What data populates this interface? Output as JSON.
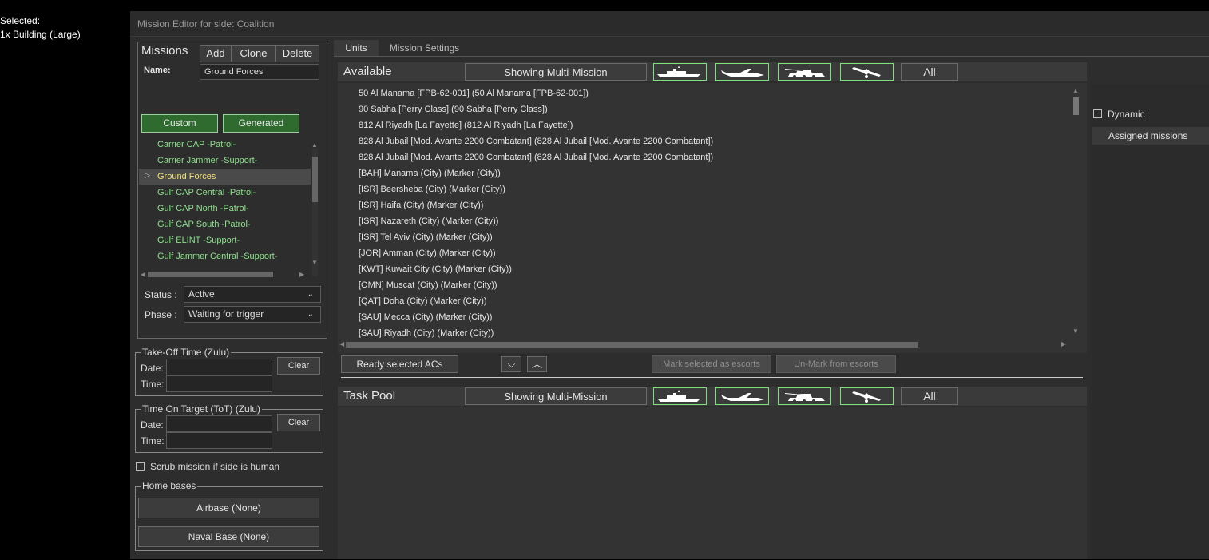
{
  "selection": {
    "line1": "Selected:",
    "line2": "1x Building (Large)"
  },
  "editor": {
    "title": "Mission Editor for side: Coalition"
  },
  "missions": {
    "header": "Missions",
    "add_label": "Add",
    "clone_label": "Clone",
    "delete_label": "Delete",
    "name_label": "Name:",
    "name_value": "Ground Forces",
    "custom_label": "Custom",
    "generated_label": "Generated",
    "items": [
      "Carrier CAP  -Patrol-",
      "Carrier Jammer  -Support-",
      "Ground Forces",
      "Gulf CAP Central  -Patrol-",
      "Gulf CAP North  -Patrol-",
      "Gulf CAP South  -Patrol-",
      "Gulf ELINT  -Support-",
      "Gulf Jammer Central  -Support-"
    ],
    "selected_index": 2,
    "status_label": "Status :",
    "status_value": "Active",
    "phase_label": "Phase :",
    "phase_value": "Waiting for trigger"
  },
  "takeoff": {
    "legend": "Take-Off Time (Zulu)",
    "date_label": "Date:",
    "time_label": "Time:",
    "clear_label": "Clear"
  },
  "tot": {
    "legend": "Time On Target (ToT) (Zulu)",
    "date_label": "Date:",
    "time_label": "Time:",
    "clear_label": "Clear"
  },
  "scrub_label": "Scrub mission if side is human",
  "home_bases": {
    "legend": "Home bases",
    "airbase": "Airbase (None)",
    "naval": "Naval Base (None)"
  },
  "tabs": {
    "units": "Units",
    "mission_settings": "Mission Settings"
  },
  "available": {
    "header": "Available",
    "filter_label": "Showing Multi-Mission",
    "all_label": "All",
    "rows": [
      "50 Al Manama [FPB-62-001] (50 Al Manama [FPB-62-001])",
      "90 Sabha [Perry Class] (90 Sabha [Perry Class])",
      "812 Al Riyadh [La Fayette] (812 Al Riyadh [La Fayette])",
      "828 Al Jubail [Mod. Avante 2200 Combatant] (828 Al Jubail [Mod. Avante 2200 Combatant])",
      "828 Al Jubail [Mod. Avante 2200 Combatant] (828 Al Jubail [Mod. Avante 2200 Combatant])",
      "[BAH] Manama (City) (Marker (City))",
      "[ISR] Beersheba (City) (Marker (City))",
      "[ISR] Haifa (City) (Marker (City))",
      "[ISR] Nazareth (City) (Marker (City))",
      "[ISR] Tel Aviv (City) (Marker (City))",
      "[JOR] Amman (City) (Marker (City))",
      "[KWT] Kuwait City (City) (Marker (City))",
      "[OMN] Muscat (City) (Marker (City))",
      "[QAT] Doha (City) (Marker (City))",
      "[SAU] Mecca (City) (Marker (City))",
      "[SAU] Riyadh (City) (Marker (City))"
    ]
  },
  "actions": {
    "ready_label": "Ready selected ACs",
    "mark_label": "Mark selected as escorts",
    "unmark_label": "Un-Mark from escorts"
  },
  "task_pool": {
    "header": "Task Pool",
    "filter_label": "Showing Multi-Mission",
    "all_label": "All"
  },
  "right_panel": {
    "dynamic_label": "Dynamic",
    "assigned_label": "Assigned missions"
  }
}
